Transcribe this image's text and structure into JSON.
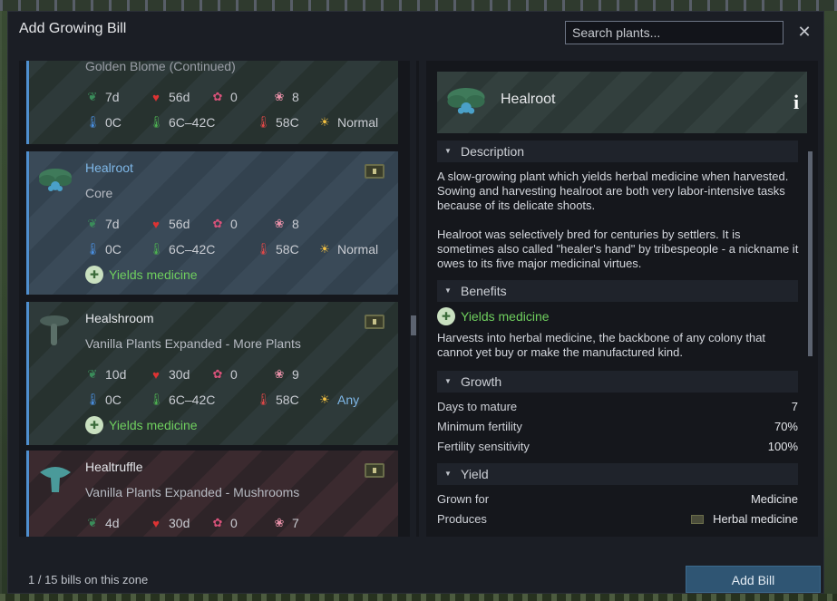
{
  "dialog": {
    "title": "Add Growing Bill",
    "close_icon": "close-icon"
  },
  "search": {
    "placeholder": "Search plants..."
  },
  "plants": [
    {
      "name": "Golden Blome (Continued)",
      "source": "",
      "stats": {
        "grow": "7d",
        "health": "56d",
        "yield": "0",
        "nutrition": "8"
      },
      "temps": {
        "min": "0C",
        "range": "6C–42C",
        "max": "58C",
        "light": "Normal"
      },
      "yields": ""
    },
    {
      "name": "Healroot",
      "source": "Core",
      "stats": {
        "grow": "7d",
        "health": "56d",
        "yield": "0",
        "nutrition": "8"
      },
      "temps": {
        "min": "0C",
        "range": "6C–42C",
        "max": "58C",
        "light": "Normal"
      },
      "yields": "Yields medicine",
      "selected": true
    },
    {
      "name": "Healshroom",
      "source": "Vanilla Plants Expanded - More Plants",
      "stats": {
        "grow": "10d",
        "health": "30d",
        "yield": "0",
        "nutrition": "9"
      },
      "temps": {
        "min": "0C",
        "range": "6C–42C",
        "max": "58C",
        "light": "Any"
      },
      "yields": "Yields medicine"
    },
    {
      "name": "Healtruffle",
      "source": "Vanilla Plants Expanded - Mushrooms",
      "stats": {
        "grow": "4d",
        "health": "30d",
        "yield": "0",
        "nutrition": "7"
      },
      "temps": {
        "min": "",
        "range": "",
        "max": "",
        "light": ""
      },
      "yields": ""
    }
  ],
  "detail": {
    "title": "Healroot",
    "sections": {
      "description": "Description",
      "benefits": "Benefits",
      "growth": "Growth",
      "yield": "Yield"
    },
    "description_p1": "A slow-growing plant which yields herbal medicine when harvested. Sowing and harvesting healroot are both very labor-intensive tasks because of its delicate shoots.",
    "description_p2": "Healroot was selectively bred for centuries by settlers. It is sometimes also called \"healer's hand\" by tribespeople - a nickname it owes to its five major medicinal virtues.",
    "benefit_label": "Yields medicine",
    "benefit_text": "Harvests into herbal medicine, the backbone of any colony that cannot yet buy or make the manufactured kind.",
    "growth": [
      {
        "k": "Days to mature",
        "v": "7"
      },
      {
        "k": "Minimum fertility",
        "v": "70%"
      },
      {
        "k": "Fertility sensitivity",
        "v": "100%"
      }
    ],
    "yield": [
      {
        "k": "Grown for",
        "v": "Medicine"
      },
      {
        "k": "Produces",
        "v": "Herbal medicine"
      }
    ]
  },
  "footer": {
    "bills_text": "1 / 15 bills on this zone",
    "add_bill_label": "Add Bill"
  },
  "colors": {
    "accent_blue": "#4f8fcf",
    "medicine_green": "#6fcf5e",
    "button_blue": "#2f5573"
  }
}
